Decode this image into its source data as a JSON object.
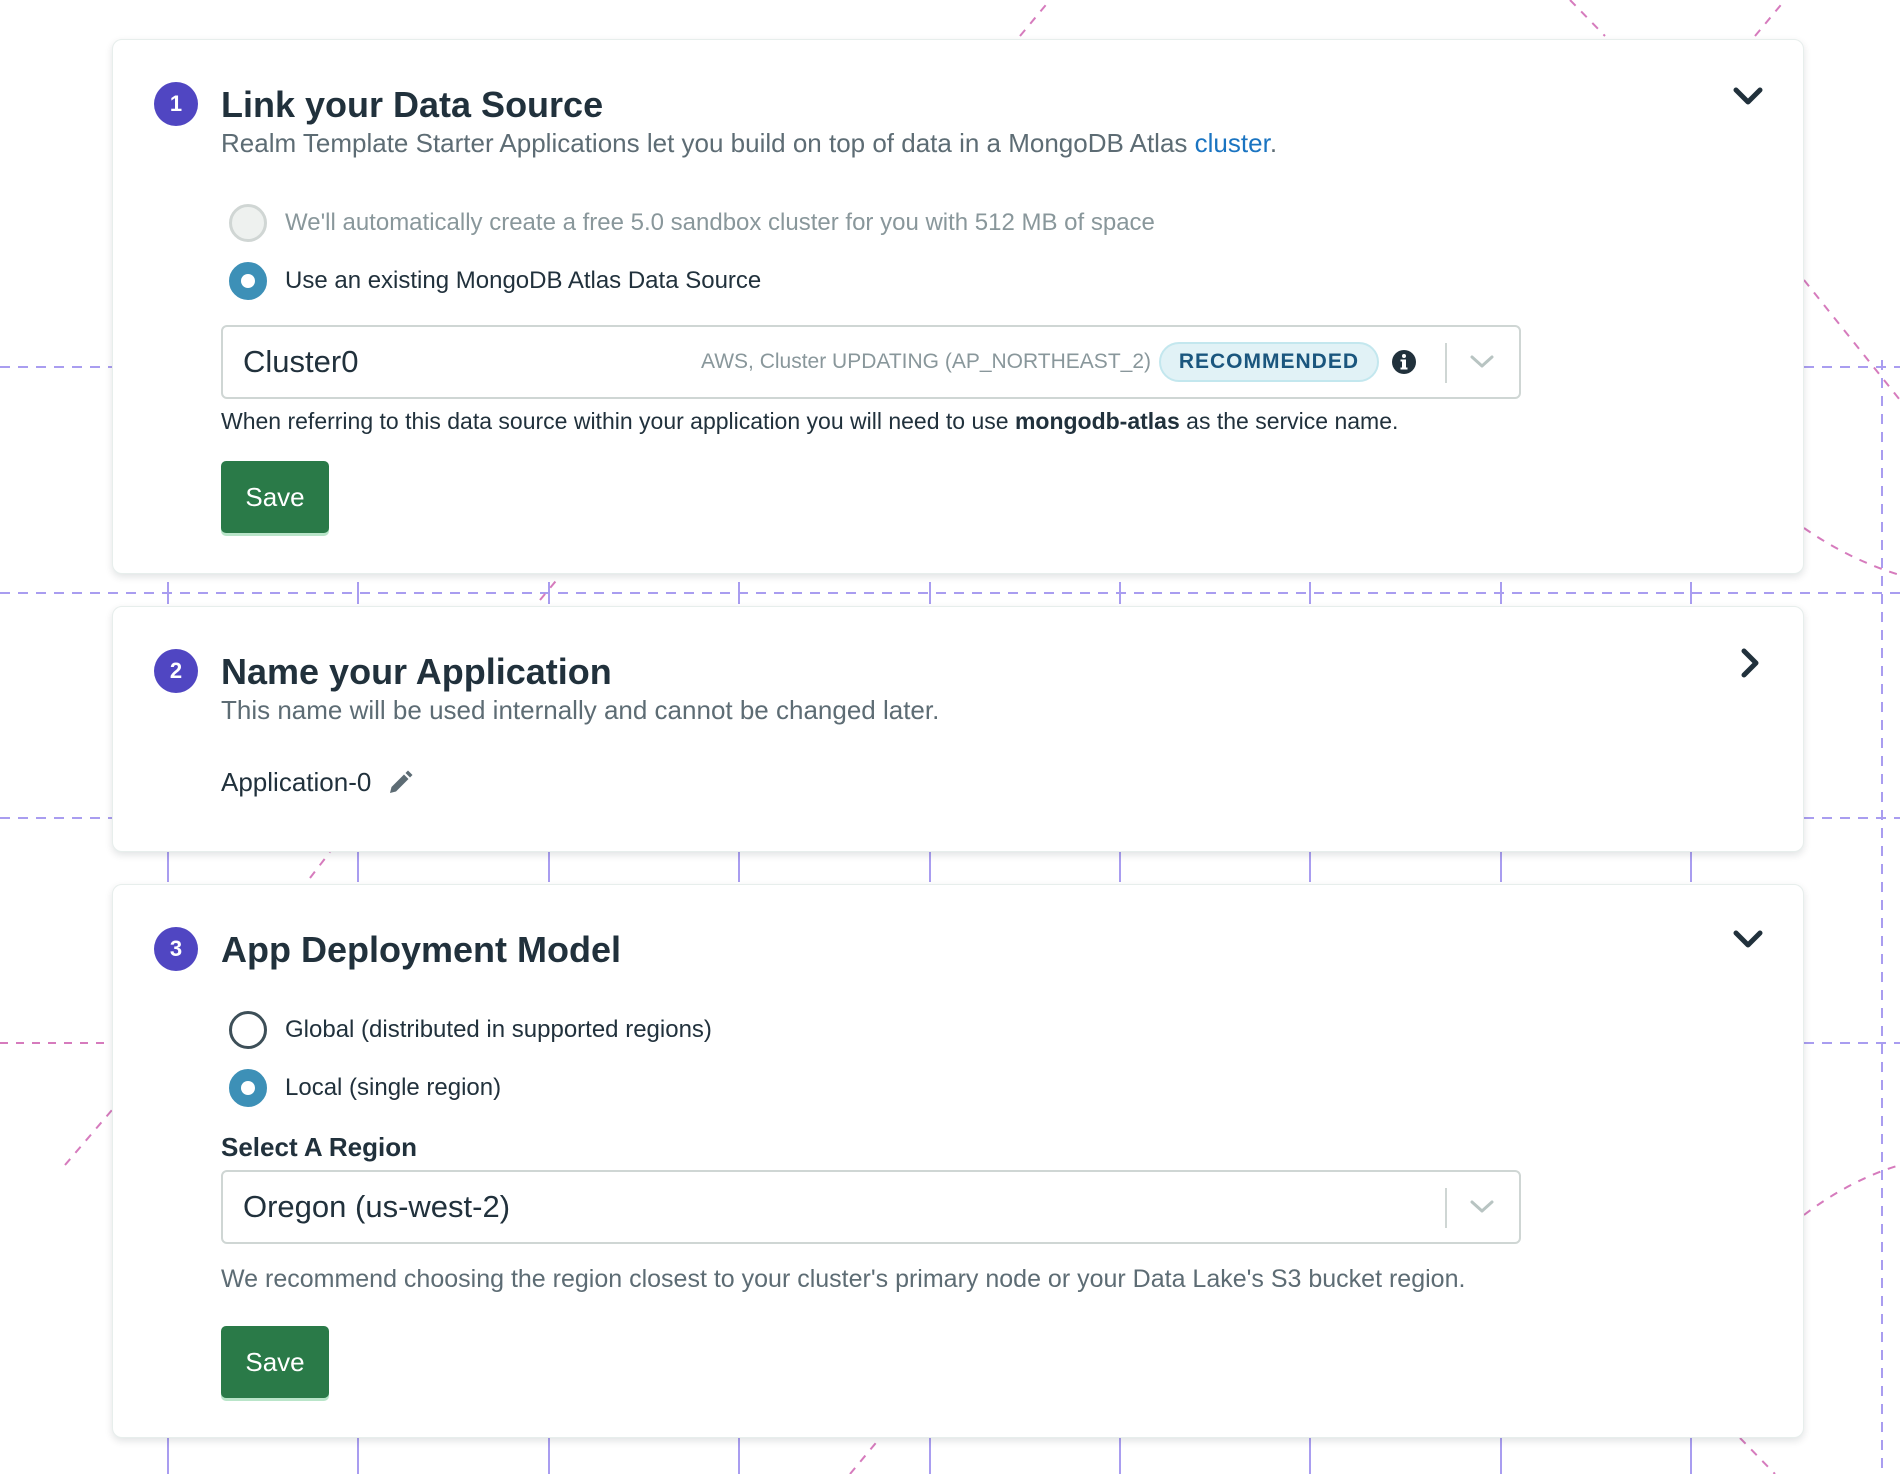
{
  "colors": {
    "step_badge": "#5046c2",
    "save_button": "#2a7a48",
    "radio_checked": "#3d90b7",
    "link": "#1a74c1",
    "recommended_badge_bg": "#e1f2f6"
  },
  "step1": {
    "number": "1",
    "title": "Link your Data Source",
    "subtitle_prefix": "Realm Template Starter Applications let you build on top of data in a MongoDB Atlas ",
    "subtitle_link": "cluster",
    "subtitle_suffix": ".",
    "chevron_icon": "chevron-down-icon",
    "options": [
      {
        "label": "We'll automatically create a free 5.0 sandbox cluster for you with 512 MB of space",
        "checked": false,
        "disabled": true
      },
      {
        "label": "Use an existing MongoDB Atlas Data Source",
        "checked": true,
        "disabled": false
      }
    ],
    "select": {
      "value": "Cluster0",
      "meta": "AWS, Cluster UPDATING (AP_NORTHEAST_2)",
      "badge": "RECOMMENDED",
      "info_icon": "info-icon",
      "chevron_icon": "chevron-down-icon"
    },
    "helper_prefix": "When referring to this data source within your application you will need to use ",
    "helper_bold": "mongodb-atlas",
    "helper_suffix": " as the service name.",
    "save_label": "Save"
  },
  "step2": {
    "number": "2",
    "title": "Name your Application",
    "subtitle": "This name will be used internally and cannot be changed later.",
    "chevron_icon": "chevron-right-icon",
    "app_name": "Application-0",
    "edit_icon": "pencil-icon"
  },
  "step3": {
    "number": "3",
    "title": "App Deployment Model",
    "chevron_icon": "chevron-down-icon",
    "options": [
      {
        "label": "Global (distributed in supported regions)",
        "checked": false
      },
      {
        "label": "Local (single region)",
        "checked": true
      }
    ],
    "region_label": "Select A Region",
    "region_value": "Oregon (us-west-2)",
    "helper": "We recommend choosing the region closest to your cluster's primary node or your Data Lake's S3 bucket region.",
    "save_label": "Save"
  }
}
